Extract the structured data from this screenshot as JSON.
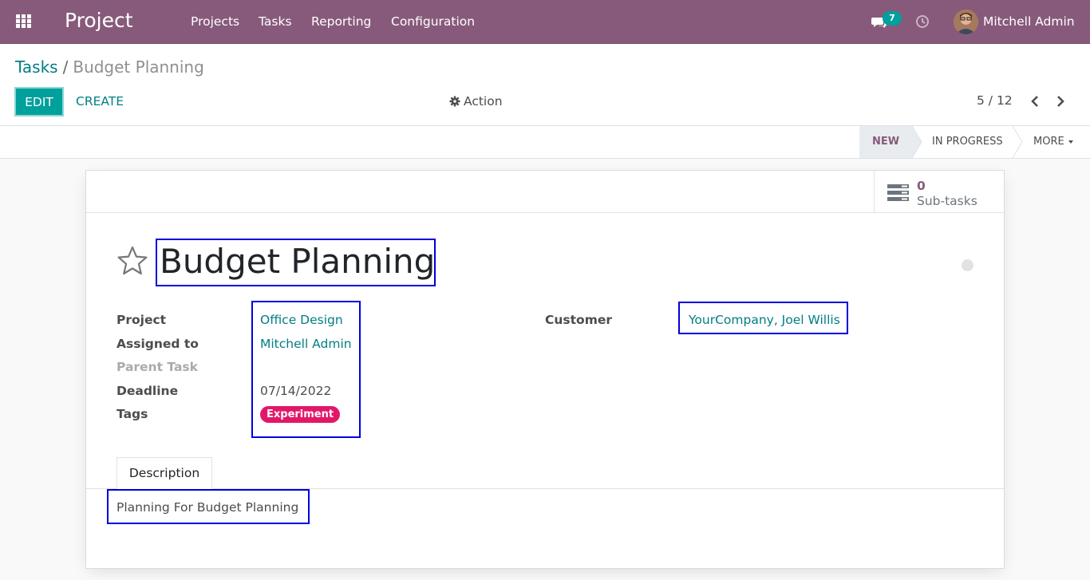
{
  "topbar": {
    "app_name": "Project",
    "menu": [
      {
        "label": "Projects"
      },
      {
        "label": "Tasks"
      },
      {
        "label": "Reporting"
      },
      {
        "label": "Configuration"
      }
    ],
    "chat_badge": "7",
    "user_name": "Mitchell Admin",
    "bg_color": "#875a7b"
  },
  "control": {
    "breadcrumb_parent": "Tasks",
    "breadcrumb_sep": "/",
    "breadcrumb_current": "Budget Planning",
    "edit_label": "EDIT",
    "create_label": "CREATE",
    "action_label": "Action",
    "pager_value": "5 / 12"
  },
  "statusbar": {
    "stages": [
      "NEW",
      "IN PROGRESS"
    ],
    "active_stage": "NEW",
    "more_label": "MORE"
  },
  "smart_button": {
    "count": "0",
    "label": "Sub-tasks"
  },
  "task": {
    "title": "Budget Planning",
    "fields": {
      "project_label": "Project",
      "project_value": "Office Design",
      "assigned_label": "Assigned to",
      "assigned_value": "Mitchell Admin",
      "parent_label": "Parent Task",
      "deadline_label": "Deadline",
      "deadline_value": "07/14/2022",
      "tags_label": "Tags",
      "tag_value": "Experiment",
      "customer_label": "Customer",
      "customer_value": "YourCompany, Joel Willis"
    },
    "tab_label": "Description",
    "description": "Planning For Budget Planning"
  },
  "colors": {
    "primary": "#00a09d",
    "link": "#017e84",
    "tag": "#e3176a",
    "highlight_box": "#0000e0"
  },
  "icons": [
    "apps-grid-icon",
    "chat-icon",
    "clock-icon",
    "gear-icon",
    "chevron-left-icon",
    "chevron-right-icon",
    "subtasks-list-icon",
    "star-icon"
  ]
}
